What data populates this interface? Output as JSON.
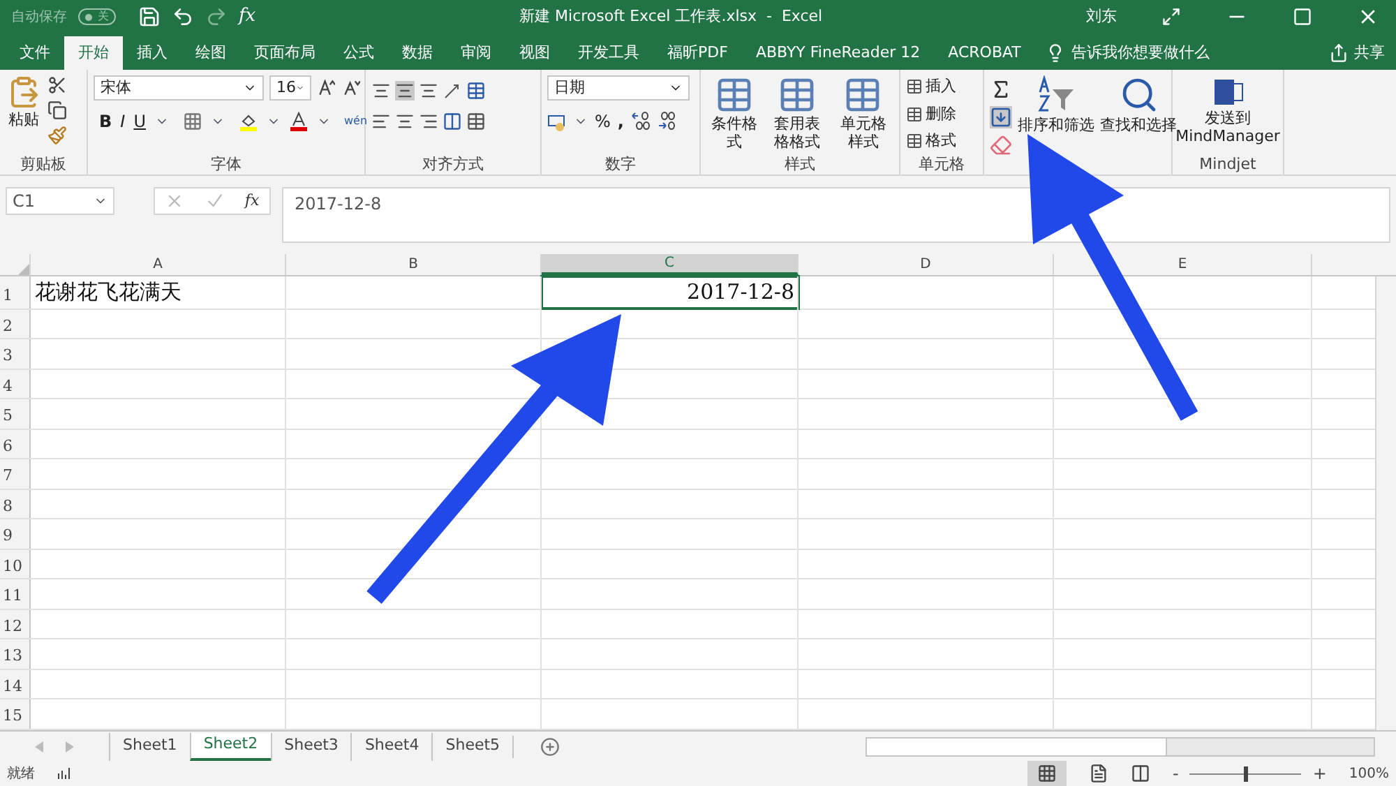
{
  "title_bar": {
    "autosave_label": "自动保存",
    "autosave": {
      "on": false,
      "state_label": "关"
    },
    "formula_glyph": "fx",
    "title": "新建 Microsoft Excel 工作表.xlsx  -  Excel",
    "user": "刘东"
  },
  "ribbon_tabs": [
    {
      "label": "文件",
      "selected": false
    },
    {
      "label": "开始",
      "selected": true
    },
    {
      "label": "插入",
      "selected": false
    },
    {
      "label": "绘图",
      "selected": false
    },
    {
      "label": "页面布局",
      "selected": false
    },
    {
      "label": "公式",
      "selected": false
    },
    {
      "label": "数据",
      "selected": false
    },
    {
      "label": "审阅",
      "selected": false
    },
    {
      "label": "视图",
      "selected": false
    },
    {
      "label": "开发工具",
      "selected": false
    },
    {
      "label": "福昕PDF",
      "selected": false
    },
    {
      "label": "ABBYY FineReader 12",
      "selected": false
    },
    {
      "label": "ACROBAT",
      "selected": false
    }
  ],
  "tell_me": "告诉我你想要做什么",
  "share": "共享",
  "ribbon": {
    "clipboard": {
      "paste": "粘贴",
      "label": "剪贴板"
    },
    "font": {
      "name": "宋体",
      "size": "16",
      "bold": "B",
      "italic": "I",
      "underline": "U",
      "phonetic": "wén",
      "label": "字体"
    },
    "alignment": {
      "label": "对齐方式"
    },
    "number": {
      "format": "日期",
      "percent": "%",
      "comma": ",",
      "label": "数字"
    },
    "styles": {
      "buttons": [
        "条件格式",
        "套用表格格式",
        "单元格样式"
      ],
      "label": "样式"
    },
    "cells": {
      "buttons": [
        "插入",
        "删除",
        "格式"
      ],
      "label": "单元格"
    },
    "editing": {
      "buttons": [
        "排序和筛选",
        "查找和选择"
      ]
    },
    "mindjet": {
      "button": "发送到\nMindManager",
      "label": "Mindjet"
    }
  },
  "formula_bar": {
    "name_box": "C1",
    "fx": "fx",
    "value": "2017-12-8"
  },
  "sheet": {
    "columns": [
      {
        "label": "A",
        "selected": false
      },
      {
        "label": "B",
        "selected": false
      },
      {
        "label": "C",
        "selected": true
      },
      {
        "label": "D",
        "selected": false
      },
      {
        "label": "E",
        "selected": false
      }
    ],
    "rows": [
      {
        "label": "1",
        "cells": [
          {
            "kind": "text",
            "value": "花谢花飞花满天",
            "selected": false
          },
          null,
          {
            "kind": "date",
            "value": "2017-12-8",
            "selected": true
          }
        ]
      },
      {
        "label": "2"
      },
      {
        "label": "3"
      },
      {
        "label": "4"
      },
      {
        "label": "5"
      },
      {
        "label": "6"
      },
      {
        "label": "7"
      },
      {
        "label": "8"
      },
      {
        "label": "9"
      },
      {
        "label": "10"
      },
      {
        "label": "11"
      },
      {
        "label": "12"
      },
      {
        "label": "13"
      },
      {
        "label": "14"
      },
      {
        "label": "15"
      }
    ]
  },
  "sheet_tabs": [
    {
      "label": "Sheet1",
      "selected": false
    },
    {
      "label": "Sheet2",
      "selected": true
    },
    {
      "label": "Sheet3",
      "selected": false
    },
    {
      "label": "Sheet4",
      "selected": false
    },
    {
      "label": "Sheet5",
      "selected": false
    }
  ],
  "status_bar": {
    "status": "就绪",
    "zoom_minus": "-",
    "zoom_plus": "+",
    "zoom": {
      "level": 0.5
    },
    "zoom_label": "100%"
  }
}
